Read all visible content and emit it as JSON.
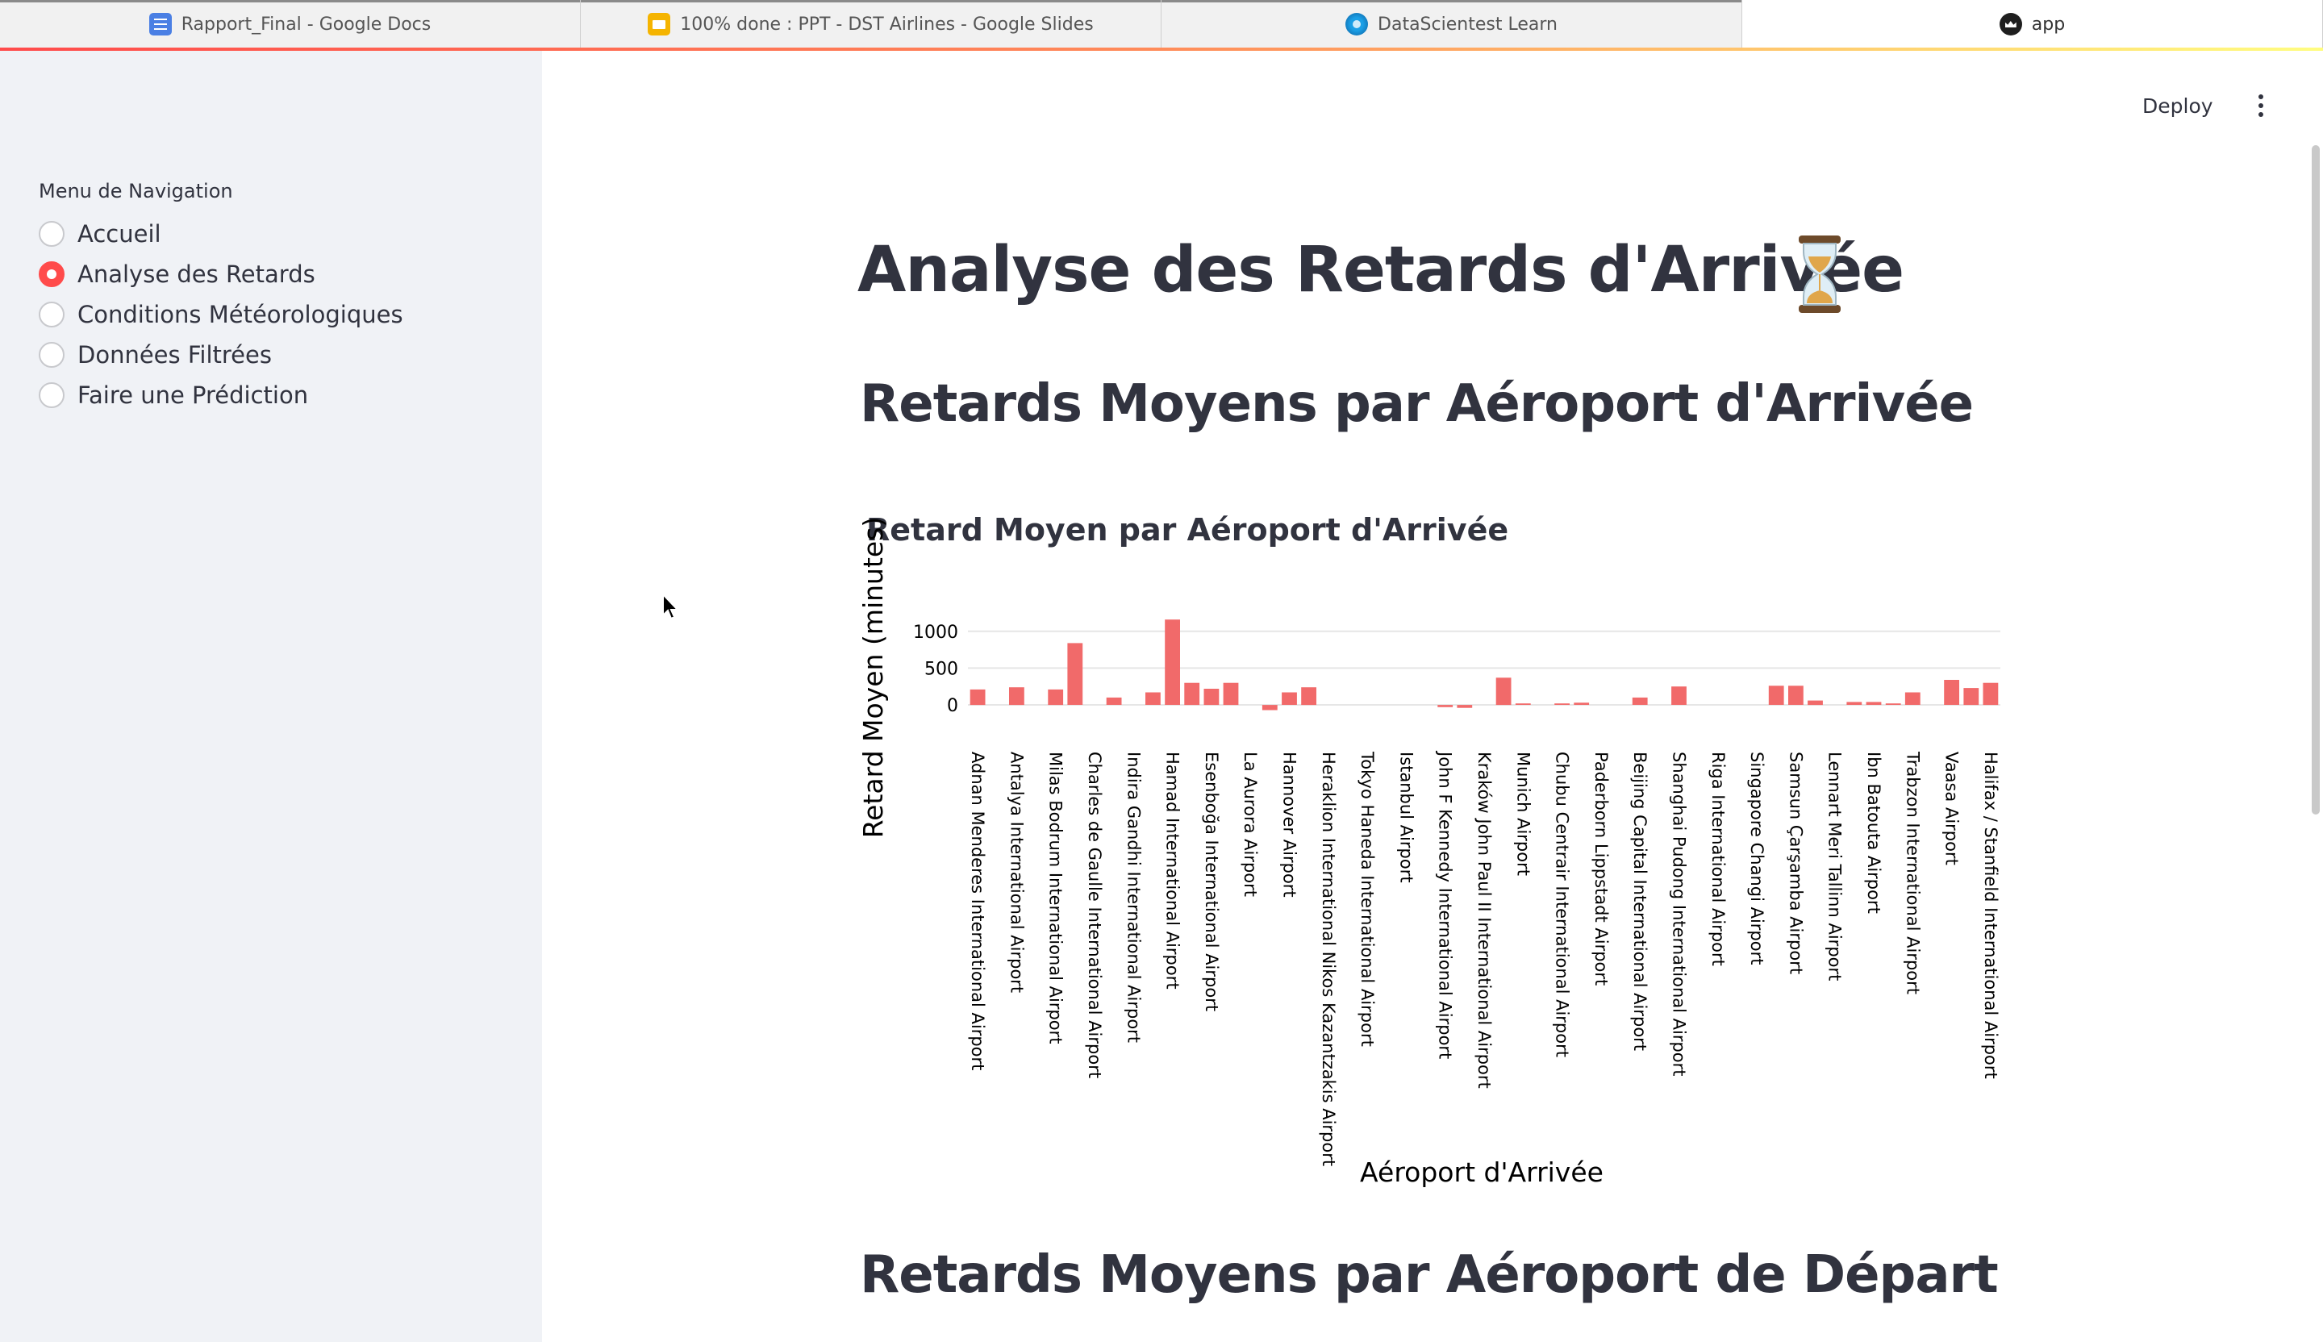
{
  "tabs": [
    {
      "label": "Rapport_Final - Google Docs",
      "icon": "google-docs-icon"
    },
    {
      "label": "100% done : PPT - DST Airlines - Google Slides",
      "icon": "google-slides-icon"
    },
    {
      "label": "DataScientest Learn",
      "icon": "datascientest-icon"
    },
    {
      "label": "app",
      "icon": "streamlit-icon"
    }
  ],
  "header": {
    "deploy_label": "Deploy",
    "menu_icon": "kebab-menu-icon"
  },
  "sidebar": {
    "title": "Menu de Navigation",
    "items": [
      {
        "label": "Accueil",
        "selected": false
      },
      {
        "label": "Analyse des Retards",
        "selected": true
      },
      {
        "label": "Conditions Météorologiques",
        "selected": false
      },
      {
        "label": "Données Filtrées",
        "selected": false
      },
      {
        "label": "Faire une Prédiction",
        "selected": false
      }
    ]
  },
  "main": {
    "title": "Analyse des Retards d'Arrivée",
    "title_icon": "hourglass-icon",
    "section1": "Retards Moyens par Aéroport d'Arrivée",
    "section2": "Retards Moyens par Aéroport de Départ"
  },
  "colors": {
    "accent": "#ff4b4b",
    "bar": "#f16a6a",
    "sidebar_bg": "#f0f2f6",
    "text": "#31333f"
  },
  "chart_data": {
    "type": "bar",
    "title": "Retard Moyen par Aéroport d'Arrivée",
    "xlabel": "Aéroport d'Arrivée",
    "ylabel": "Retard Moyen (minutes)",
    "yticks": [
      0,
      500,
      1000
    ],
    "ylim": [
      -120,
      1250
    ],
    "grid": true,
    "categories": [
      "Adnan Menderes International Airport",
      "",
      "Antalya International Airport",
      "",
      "Milas Bodrum International Airport",
      "",
      "Charles de Gaulle International Airport",
      "",
      "Indira Gandhi International Airport",
      "",
      "Hamad International Airport",
      "",
      "Esenboğa International Airport",
      "",
      "La Aurora Airport",
      "",
      "Hannover Airport",
      "",
      "Heraklion International Nikos Kazantzakis Airport",
      "",
      "Tokyo Haneda International Airport",
      "",
      "Istanbul Airport",
      "",
      "John F Kennedy International Airport",
      "",
      "Kraków John Paul II International Airport",
      "",
      "Munich Airport",
      "",
      "Chubu Centrair International Airport",
      "",
      "Paderborn Lippstadt Airport",
      "",
      "Beijing Capital International Airport",
      "",
      "Shanghai Pudong International Airport",
      "",
      "Riga International Airport",
      "",
      "Singapore Changi Airport",
      "",
      "Samsun Çarşamba Airport",
      "",
      "Lennart Meri Tallinn Airport",
      "",
      "Ibn Batouta Airport",
      "",
      "Trabzon International Airport",
      "",
      "Vaasa Airport",
      "",
      "Halifax / Stanfield International Airport",
      ""
    ],
    "values": [
      210,
      0,
      240,
      0,
      210,
      840,
      0,
      100,
      0,
      170,
      1160,
      300,
      220,
      300,
      0,
      -70,
      170,
      240,
      0,
      0,
      0,
      0,
      0,
      0,
      -30,
      -40,
      0,
      370,
      20,
      0,
      20,
      30,
      0,
      0,
      100,
      0,
      250,
      0,
      0,
      0,
      0,
      260,
      260,
      60,
      0,
      40,
      40,
      20,
      170,
      0,
      340,
      230,
      300
    ]
  }
}
